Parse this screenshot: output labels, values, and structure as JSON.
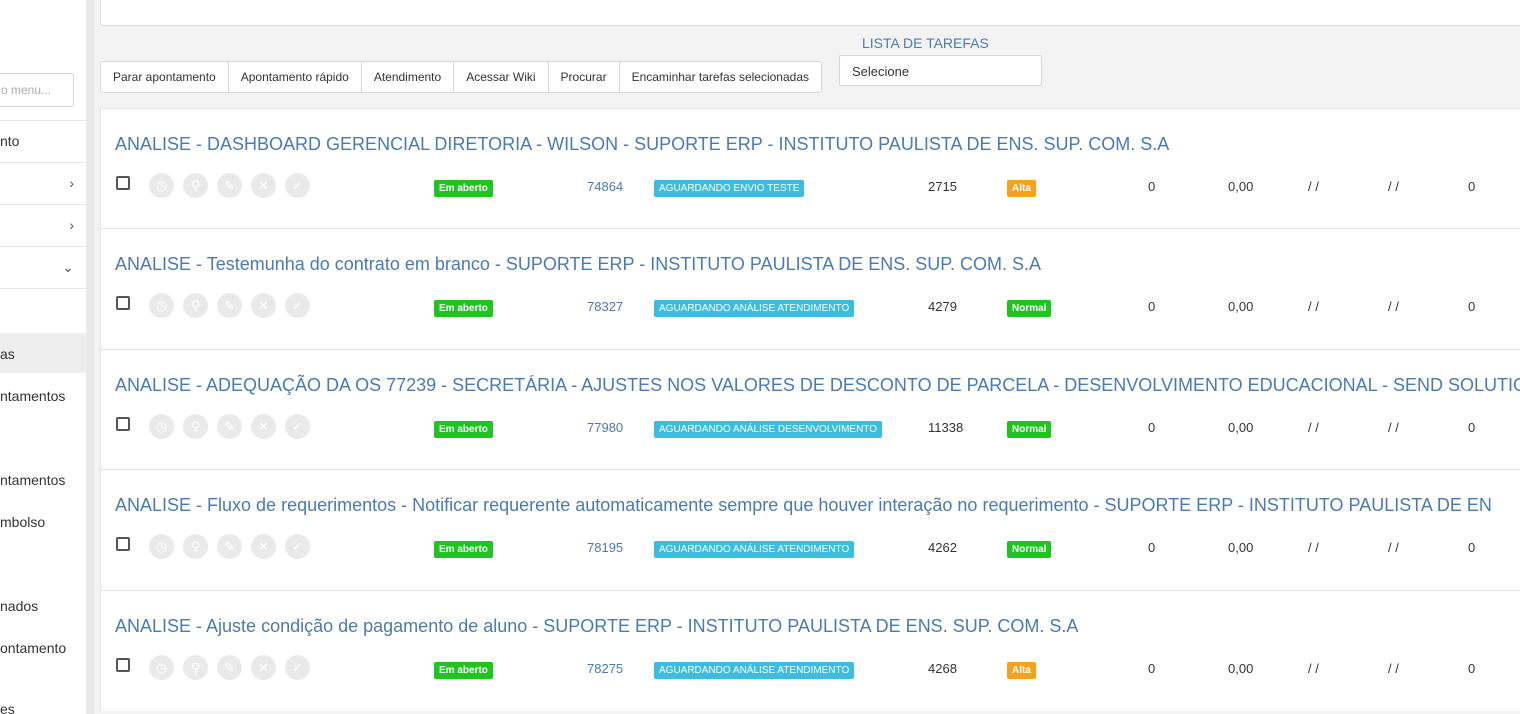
{
  "sidebar": {
    "search_placeholder": "o menu...",
    "items": [
      {
        "label": "nto"
      },
      {
        "label": "as"
      },
      {
        "label": "ntamentos"
      },
      {
        "label": "ntamentos"
      },
      {
        "label": "mbolso"
      },
      {
        "label": "nados"
      },
      {
        "label": "ontamento"
      },
      {
        "label": "es"
      }
    ],
    "chevrons": [
      "›",
      "›",
      "⌄"
    ]
  },
  "toolbar": {
    "buttons": [
      "Parar apontamento",
      "Apontamento rápido",
      "Atendimento",
      "Acessar Wiki",
      "Procurar",
      "Encaminhar tarefas selecionadas"
    ],
    "task_list_label": "LISTA DE TAREFAS",
    "task_select_value": "Selecione"
  },
  "colors": {
    "link": "#4a7ab3",
    "open_badge": "#1ec51e",
    "status_badge": "#3bbde2",
    "priority_alta": "#f7a21b",
    "priority_normal": "#1ec51e"
  },
  "tasks": [
    {
      "title": "ANALISE - DASHBOARD GERENCIAL DIRETORIA - WILSON - SUPORTE ERP - INSTITUTO PAULISTA DE ENS. SUP. COM. S.A",
      "state": "Em aberto",
      "id": "74864",
      "status": "AGUARDANDO ENVIO TESTE",
      "code": "2715",
      "priority": "Alta",
      "c1": "0",
      "c2": "0,00",
      "d1": "/ /",
      "d2": "/ /",
      "c3": "0"
    },
    {
      "title": "ANALISE - Testemunha do contrato em branco - SUPORTE ERP - INSTITUTO PAULISTA DE ENS. SUP. COM. S.A",
      "state": "Em aberto",
      "id": "78327",
      "status": "AGUARDANDO ANÁLISE ATENDIMENTO",
      "code": "4279",
      "priority": "Normal",
      "c1": "0",
      "c2": "0,00",
      "d1": "/ /",
      "d2": "/ /",
      "c3": "0"
    },
    {
      "title": "ANALISE - ADEQUAÇÃO DA OS 77239 - SECRETÁRIA - AJUSTES NOS VALORES DE DESCONTO DE PARCELA - DESENVOLVIMENTO EDUCACIONAL - SEND SOLUTIONS LT",
      "state": "Em aberto",
      "id": "77980",
      "status": "AGUARDANDO ANÁLISE DESENVOLVIMENTO",
      "code": "11338",
      "priority": "Normal",
      "c1": "0",
      "c2": "0,00",
      "d1": "/ /",
      "d2": "/ /",
      "c3": "0"
    },
    {
      "title": "ANALISE - Fluxo de requerimentos - Notificar requerente automaticamente sempre que houver interação no requerimento - SUPORTE ERP - INSTITUTO PAULISTA DE EN",
      "state": "Em aberto",
      "id": "78195",
      "status": "AGUARDANDO ANÁLISE ATENDIMENTO",
      "code": "4262",
      "priority": "Normal",
      "c1": "0",
      "c2": "0,00",
      "d1": "/ /",
      "d2": "/ /",
      "c3": "0"
    },
    {
      "title": "ANALISE - Ajuste condição de pagamento de aluno - SUPORTE ERP - INSTITUTO PAULISTA DE ENS. SUP. COM. S.A",
      "state": "Em aberto",
      "id": "78275",
      "status": "AGUARDANDO ANÁLISE ATENDIMENTO",
      "code": "4268",
      "priority": "Alta",
      "c1": "0",
      "c2": "0,00",
      "d1": "/ /",
      "d2": "/ /",
      "c3": "0"
    }
  ]
}
